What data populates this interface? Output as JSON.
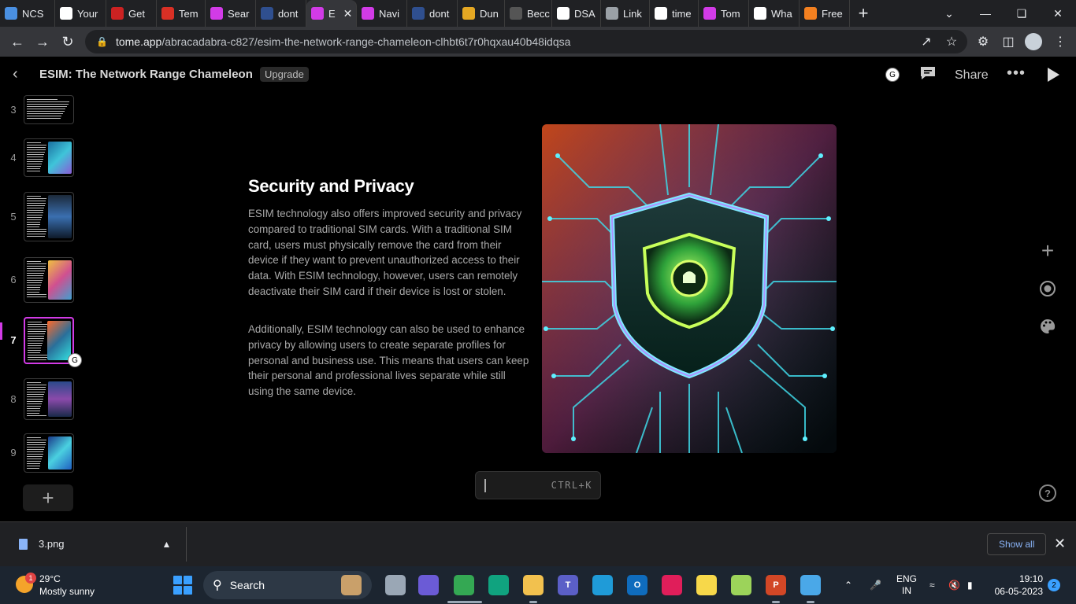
{
  "browser": {
    "tabs": [
      {
        "label": "NCS",
        "icon": "ncs-favicon",
        "color": "#4a90e2"
      },
      {
        "label": "Your",
        "icon": "si-favicon",
        "color": "#ffffff"
      },
      {
        "label": "Get",
        "icon": "get-favicon",
        "color": "#cc2222"
      },
      {
        "label": "Tem",
        "icon": "mail-favicon",
        "color": "#d93025"
      },
      {
        "label": "Sear",
        "icon": "tome-favicon",
        "color": "#d23be7"
      },
      {
        "label": "dont",
        "icon": "pt-favicon",
        "color": "#2f4f8f"
      },
      {
        "label": "E",
        "icon": "tome-favicon",
        "color": "#d23be7",
        "active": true
      },
      {
        "label": "Navi",
        "icon": "tome-favicon",
        "color": "#d23be7"
      },
      {
        "label": "dont",
        "icon": "pt-favicon",
        "color": "#2f4f8f"
      },
      {
        "label": "Dun",
        "icon": "crown-favicon",
        "color": "#e5a823"
      },
      {
        "label": "Becc",
        "icon": "becc-favicon",
        "color": "#555555"
      },
      {
        "label": "DSA",
        "icon": "github-favicon",
        "color": "#ffffff"
      },
      {
        "label": "Link",
        "icon": "globe-favicon",
        "color": "#9aa0a6"
      },
      {
        "label": "time",
        "icon": "google-favicon",
        "color": "#ffffff"
      },
      {
        "label": "Tom",
        "icon": "tome-favicon",
        "color": "#d23be7"
      },
      {
        "label": "Wha",
        "icon": "wha-favicon",
        "color": "#ffffff"
      },
      {
        "label": "Free",
        "icon": "free-favicon",
        "color": "#f38020"
      }
    ],
    "url_host": "tome.app",
    "url_path": "/abracadabra-c827/esim-the-network-range-chameleon-clhbt6t7r0hqxau40b48idqsa"
  },
  "app": {
    "doc_title": "ESIM: The Network Range Chameleon",
    "upgrade_label": "Upgrade",
    "share_label": "Share",
    "presence_initial": "G"
  },
  "thumbnails": [
    {
      "num": "3",
      "pic": null
    },
    {
      "num": "4",
      "pic": "linear-gradient(135deg,#1a6fa0,#3fc4d9,#8a5cd6)"
    },
    {
      "num": "5",
      "pic": "linear-gradient(180deg,#1c2a3a,#3a6fb0,#0e1a2a)"
    },
    {
      "num": "6",
      "pic": "linear-gradient(135deg,#f0c040,#d05090,#40a0d0)"
    },
    {
      "num": "7",
      "pic": "linear-gradient(135deg,#ff6a2a,#2a6f9a,#33e0e0)",
      "active": true
    },
    {
      "num": "8",
      "pic": "linear-gradient(180deg,#2a4a8a,#8a4aaa,#1a2a4a)"
    },
    {
      "num": "9",
      "pic": "linear-gradient(135deg,#1a3a8a,#4ad0e0,#2060c0)"
    }
  ],
  "slide": {
    "title": "Security and Privacy",
    "paragraphs": [
      "ESIM technology also offers improved security and privacy compared to traditional SIM cards. With a traditional SIM card, users must physically remove the card from their device if they want to prevent unauthorized access to their data. With ESIM technology, however, users can remotely deactivate their SIM card if their device is lost or stolen.",
      "Additionally, ESIM technology can also be used to enhance privacy by allowing users to create separate profiles for personal and business use. This means that users can keep their personal and professional lives separate while still using the same device."
    ]
  },
  "command_bar": {
    "hint": "CTRL+K"
  },
  "downloads": {
    "file_name": "3.png",
    "show_all_label": "Show all"
  },
  "taskbar": {
    "temperature": "29°C",
    "condition": "Mostly sunny",
    "weather_badge": "1",
    "search_label": "Search",
    "language_line1": "ENG",
    "language_line2": "IN",
    "time": "19:10",
    "date": "06-05-2023",
    "notification_count": "2"
  }
}
